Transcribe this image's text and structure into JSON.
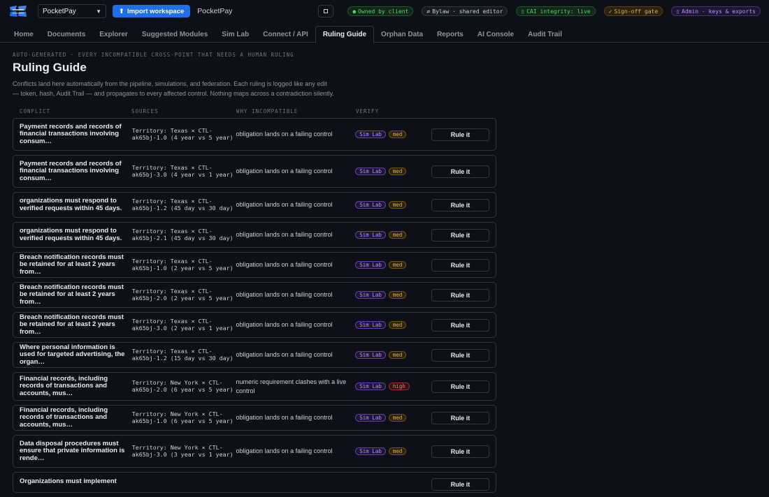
{
  "header": {
    "workspace_select": "PocketPay",
    "import_label": "Import workspace",
    "workspace_name": "PocketPay",
    "pills": [
      {
        "label": "Owned by client",
        "color": "green"
      },
      {
        "label": "Bylaw · shared editor",
        "color": "gray"
      },
      {
        "label": "CAI integrity: live",
        "color": "green"
      },
      {
        "label": "Sign-off gate",
        "color": "yellow"
      },
      {
        "label": "Admin · keys & exports",
        "color": "purple"
      }
    ]
  },
  "nav": {
    "tabs": [
      "Home",
      "Documents",
      "Explorer",
      "Suggested Modules",
      "Sim Lab",
      "Connect / API",
      "Ruling Guide",
      "Orphan Data",
      "Reports",
      "AI Console",
      "Audit Trail"
    ],
    "active": "Ruling Guide"
  },
  "page": {
    "eyebrow": "AUTO-GENERATED · EVERY INCOMPATIBLE CROSS-POINT THAT NEEDS A HUMAN RULING",
    "title": "Ruling Guide",
    "description": "Conflicts land here automatically from the pipeline, simulations, and federation. Each ruling is logged like any edit — token, hash, Audit Trail — and propagates to every affected control. Nothing maps across a contradiction silently."
  },
  "table": {
    "columns": [
      "CONFLICT",
      "SOURCES",
      "WHY INCOMPATIBLE",
      "VERIFY"
    ],
    "action_label": "Rule it",
    "rows": [
      {
        "conflict": "Payment records and records of financial transactions involving consum…",
        "source": "Territory: Texas × CTL-ak65bj-1.0 (4 year vs 5 year)",
        "why": "obligation lands on a failing control",
        "badge": "Sim Lab",
        "severity": "med"
      },
      {
        "conflict": "Payment records and records of financial transactions involving consum…",
        "source": "Territory: Texas × CTL-ak65bj-3.0 (4 year vs 1 year)",
        "why": "obligation lands on a failing control",
        "badge": "Sim Lab",
        "severity": "med"
      },
      {
        "conflict": "organizations must respond to verified requests within 45 days.",
        "source": "Territory: Texas × CTL-ak65bj-1.2 (45 day vs 30 day)",
        "why": "obligation lands on a failing control",
        "badge": "Sim Lab",
        "severity": "med"
      },
      {
        "conflict": "organizations must respond to verified requests within 45 days.",
        "source": "Territory: Texas × CTL-ak65bj-2.1 (45 day vs 30 day)",
        "why": "obligation lands on a failing control",
        "badge": "Sim Lab",
        "severity": "med"
      },
      {
        "conflict": "Breach notification records must be retained for at least 2 years from…",
        "source": "Territory: Texas × CTL-ak65bj-1.0 (2 year vs 5 year)",
        "why": "obligation lands on a failing control",
        "badge": "Sim Lab",
        "severity": "med"
      },
      {
        "conflict": "Breach notification records must be retained for at least 2 years from…",
        "source": "Territory: Texas × CTL-ak65bj-2.0 (2 year vs 5 year)",
        "why": "obligation lands on a failing control",
        "badge": "Sim Lab",
        "severity": "med"
      },
      {
        "conflict": "Breach notification records must be retained for at least 2 years from…",
        "source": "Territory: Texas × CTL-ak65bj-3.0 (2 year vs 1 year)",
        "why": "obligation lands on a failing control",
        "badge": "Sim Lab",
        "severity": "med"
      },
      {
        "conflict": "Where personal information is used for targeted advertising, the organ…",
        "source": "Territory: Texas × CTL-ak65bj-1.2 (15 day vs 30 day)",
        "why": "obligation lands on a failing control",
        "badge": "Sim Lab",
        "severity": "med"
      },
      {
        "conflict": "Financial records, including records of transactions and accounts, mus…",
        "source": "Territory: New York × CTL-ak65bj-2.0 (6 year vs 5 year)",
        "why": "numeric requirement clashes with a live control",
        "badge": "Sim Lab",
        "severity": "high"
      },
      {
        "conflict": "Financial records, including records of transactions and accounts, mus…",
        "source": "Territory: New York × CTL-ak65bj-1.0 (6 year vs 5 year)",
        "why": "obligation lands on a failing control",
        "badge": "Sim Lab",
        "severity": "med"
      },
      {
        "conflict": "Data disposal procedures must ensure that private information is rende…",
        "source": "Territory: New York × CTL-ak65bj-3.0 (3 year vs 1 year)",
        "why": "obligation lands on a failing control",
        "badge": "Sim Lab",
        "severity": "med"
      },
      {
        "conflict": "Organizations must implement",
        "source": "",
        "why": "",
        "badge": "",
        "severity": ""
      }
    ]
  }
}
